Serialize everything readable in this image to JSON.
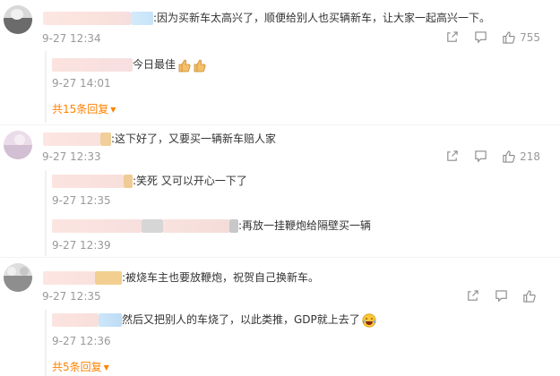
{
  "comments": [
    {
      "text": ":因为买新车太高兴了，顺便给别人也买辆新车，让大家一起高兴一下。",
      "time": "9-27 12:34",
      "likes": "755",
      "replies": [
        {
          "text": "今日最佳",
          "time": "9-27 14:01"
        }
      ],
      "more": "共15条回复"
    },
    {
      "text": ":这下好了，又要买一辆新车赔人家",
      "time": "9-27 12:33",
      "likes": "218",
      "replies": [
        {
          "text": ":笑死 又可以开心一下了",
          "time": "9-27 12:35"
        },
        {
          "text": ":再放一挂鞭炮给隔壁买一辆",
          "time": "9-27 12:39"
        }
      ]
    },
    {
      "text": ":被烧车主也要放鞭炮，祝贺自己换新车。",
      "time": "9-27 12:35",
      "likes": "",
      "replies": [
        {
          "text": "然后又把别人的车烧了，以此类推，GDP就上去了",
          "time": "9-27 12:36"
        }
      ],
      "more": "共5条回复"
    }
  ],
  "icons": {
    "share": "share-icon",
    "comment": "comment-icon",
    "like": "like-icon"
  },
  "colors": {
    "accent": "#ff8200",
    "meta": "#999999",
    "text": "#333333"
  }
}
